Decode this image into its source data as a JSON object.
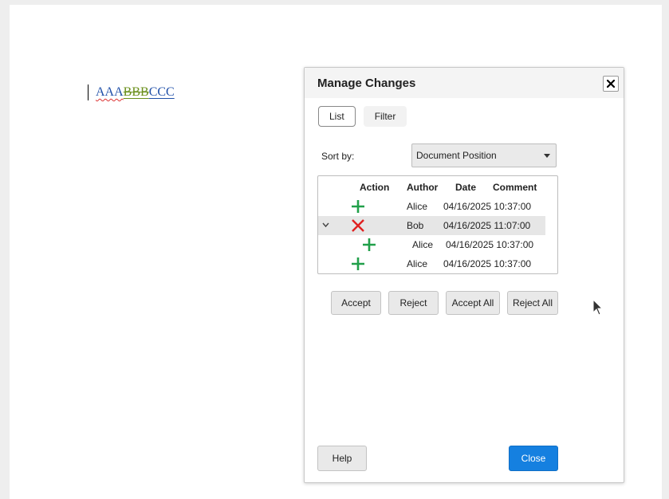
{
  "document": {
    "segments": [
      "AAA",
      "BBB",
      "CCC"
    ]
  },
  "dialog": {
    "title": "Manage Changes",
    "tabs": [
      {
        "label": "List",
        "active": true
      },
      {
        "label": "Filter",
        "active": false
      }
    ],
    "sort": {
      "label": "Sort by:",
      "value": "Document Position"
    },
    "columns": {
      "action": "Action",
      "author": "Author",
      "date": "Date",
      "comment": "Comment"
    },
    "rows": [
      {
        "action": "insert",
        "author": "Alice",
        "date": "04/16/2025 10:37:00",
        "comment": ""
      },
      {
        "action": "delete",
        "author": "Bob",
        "date": "04/16/2025 11:07:00",
        "comment": "",
        "expanded": true
      },
      {
        "action": "insert",
        "author": "Alice",
        "date": "04/16/2025 10:37:00",
        "comment": "",
        "child": true
      },
      {
        "action": "insert",
        "author": "Alice",
        "date": "04/16/2025 10:37:00",
        "comment": ""
      }
    ],
    "buttons": {
      "accept": "Accept",
      "reject": "Reject",
      "accept_all": "Accept All",
      "reject_all": "Reject All",
      "help": "Help",
      "close": "Close"
    }
  },
  "colors": {
    "insert": "#21a04a",
    "delete": "#e02020",
    "primary": "#1580e0"
  }
}
